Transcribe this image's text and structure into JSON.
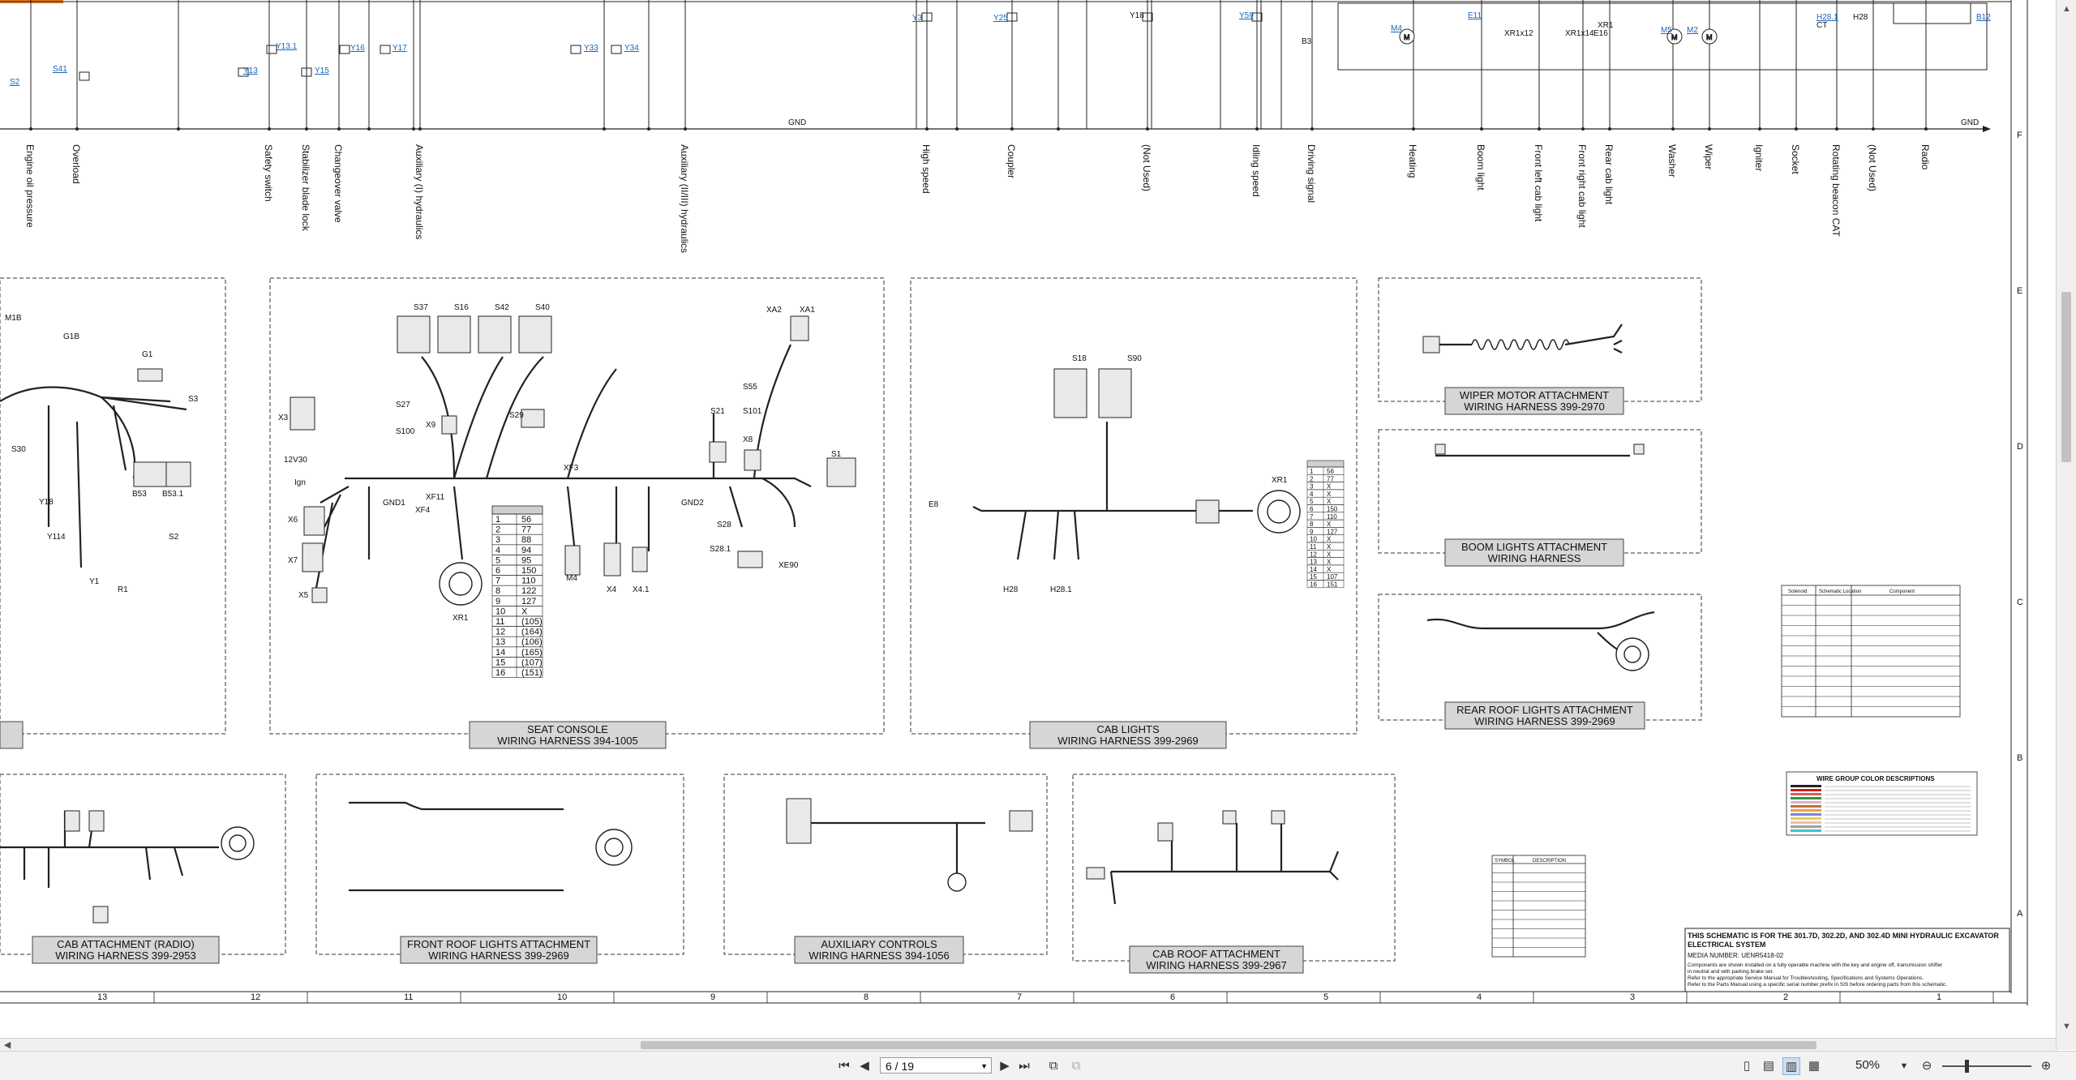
{
  "viewer": {
    "page_current": "6 / 19",
    "zoom": "50%"
  },
  "schematic": {
    "gnd_label": "GND",
    "top_labels": [
      "S2",
      "S41",
      "Y13",
      "Y13.1",
      "Y15",
      "Y16",
      "Y17",
      "Y33",
      "Y34",
      "Y3",
      "Y25",
      "Y18",
      "Y59",
      "B3",
      "M4",
      "E11",
      "XR1x12",
      "XR1x14",
      "XR1",
      "M5",
      "M2",
      "H28.1",
      "H28",
      "B12",
      "E16",
      "CT"
    ],
    "circuits": [
      "Engine oil pressure",
      "Overload",
      "Safety switch",
      "Stabilizer blade lock",
      "Changeover valve",
      "Auxiliary (I) hydraulics",
      "Auxiliary (II/III) hydraulics",
      "High speed",
      "Coupler",
      "(Not Used)",
      "Idling speed",
      "Driving signal",
      "Heating",
      "Boom light",
      "Front left cab light",
      "Front right cab light",
      "Rear cab light",
      "Washer",
      "Wiper",
      "Igniter",
      "Socket",
      "Rotating beacon CAT",
      "(Not Used)",
      "Radio"
    ],
    "harness_titles": [
      {
        "line1": "SEAT CONSOLE",
        "line2": "WIRING HARNESS 394-1005"
      },
      {
        "line1": "CAB LIGHTS",
        "line2": "WIRING HARNESS 399-2969"
      },
      {
        "line1": "WIPER MOTOR  ATTACHMENT",
        "line2": "WIRING HARNESS 399-2970"
      },
      {
        "line1": "BOOM LIGHTS ATTACHMENT",
        "line2": "WIRING HARNESS"
      },
      {
        "line1": "REAR ROOF LIGHTS ATTACHMENT",
        "line2": "WIRING HARNESS 399-2969"
      },
      {
        "line1": "CAB ATTACHMENT (RADIO)",
        "line2": "WIRING HARNESS 399-2953"
      },
      {
        "line1": "FRONT ROOF LIGHTS ATTACHMENT",
        "line2": "WIRING HARNESS 399-2969"
      },
      {
        "line1": "AUXILIARY CONTROLS",
        "line2": "WIRING HARNESS 394-1056"
      },
      {
        "line1": "CAB ROOF  ATTACHMENT",
        "line2": "WIRING HARNESS 399-2967"
      }
    ],
    "seat_console_labels": [
      "X3",
      "S27",
      "S100",
      "X9",
      "S29",
      "S37",
      "S16",
      "S42",
      "S40",
      "XA2",
      "XA1",
      "S55",
      "S101",
      "S21",
      "X8",
      "S1",
      "12V30",
      "Ign",
      "X6",
      "X7",
      "X5",
      "GND1",
      "XF4",
      "XF11",
      "XF3",
      "GND2",
      "S28",
      "S28.1",
      "XE90",
      "M4",
      "X4",
      "X4.1",
      "XR1"
    ],
    "seat_console_table": [
      [
        "1",
        "56"
      ],
      [
        "2",
        "77"
      ],
      [
        "3",
        "88"
      ],
      [
        "4",
        "94"
      ],
      [
        "5",
        "95"
      ],
      [
        "6",
        "150"
      ],
      [
        "7",
        "110"
      ],
      [
        "8",
        "122"
      ],
      [
        "9",
        "127"
      ],
      [
        "10",
        "X"
      ],
      [
        "11",
        "(105)"
      ],
      [
        "12",
        "(164)"
      ],
      [
        "13",
        "(106)"
      ],
      [
        "14",
        "(165)"
      ],
      [
        "15",
        "(107)"
      ],
      [
        "16",
        "(151)"
      ]
    ],
    "cab_lights_table": [
      [
        "1",
        "56"
      ],
      [
        "2",
        "77"
      ],
      [
        "3",
        "X"
      ],
      [
        "4",
        "X"
      ],
      [
        "5",
        "X"
      ],
      [
        "6",
        "150"
      ],
      [
        "7",
        "110"
      ],
      [
        "8",
        "X"
      ],
      [
        "9",
        "127"
      ],
      [
        "10",
        "X"
      ],
      [
        "11",
        "X"
      ],
      [
        "12",
        "X"
      ],
      [
        "13",
        "X"
      ],
      [
        "14",
        "X"
      ],
      [
        "15",
        "107"
      ],
      [
        "16",
        "151"
      ]
    ],
    "left_panel_labels": [
      "M1B",
      "G1B",
      "G1",
      "S3",
      "S30",
      "Y18",
      "Y114",
      "B53",
      "B53.1",
      "S2",
      "Y1",
      "R1"
    ],
    "cab_lights_labels": [
      "S18",
      "S90",
      "E8",
      "H28",
      "H28.1",
      "XR1"
    ],
    "legend_table_title": "WIRE GROUP COLOR DESCRIPTIONS",
    "symbol_header": [
      "SYMBOL",
      "DESCRIPTION"
    ],
    "solenoid_header": [
      "Solenoid",
      "Schematic Location",
      "Component"
    ],
    "notes": {
      "line1": "THIS SCHEMATIC IS FOR THE 301.7D, 302.2D, AND 302.4D MINI HYDRAULIC EXCAVATOR",
      "line2": "ELECTRICAL SYSTEM",
      "line3": "MEDIA NUMBER: UENR5418-02",
      "line4": "Components are shown installed on a fully operable machine with the key and engine off, transmission shifter",
      "line5": "in neutral and with parking brake set.",
      "line6": "Refer to the appropriate Service Manual for Troubleshooting, Specifications and Systems Operations.",
      "line7": "Refer to the Parts Manual using a specific serial number prefix in SIS before ordering parts from this schematic."
    },
    "grid_columns": [
      "13",
      "12",
      "11",
      "10",
      "9",
      "8",
      "7",
      "6",
      "5",
      "4",
      "3",
      "2",
      "1"
    ],
    "grid_rows": [
      "F",
      "E",
      "D",
      "C",
      "B",
      "A"
    ]
  }
}
